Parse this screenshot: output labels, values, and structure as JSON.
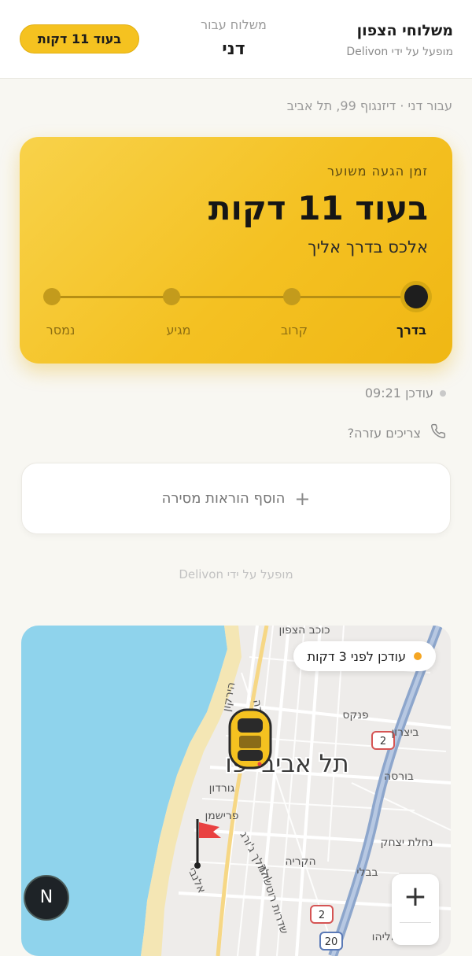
{
  "header": {
    "brand_title": "משלוחי הצפון",
    "brand_subtitle": "מופעל על ידי Delivon",
    "for_label": "משלוח עבור",
    "for_name": "דני",
    "eta_pill": "בעוד 11 דקות"
  },
  "address": "עבור דני · דיזנגוף 99, תל אביב",
  "status_card": {
    "label": "זמן הגעה משוער",
    "eta": "בעוד 11 דקות",
    "driver_line": "אלכס בדרך אליך",
    "steps": [
      {
        "label": "בדרך",
        "active": true
      },
      {
        "label": "קרוב",
        "active": false
      },
      {
        "label": "מגיע",
        "active": false
      },
      {
        "label": "נמסר",
        "active": false
      }
    ]
  },
  "updated_text": "עודכן 09:21",
  "help_text": "צריכים עזרה?",
  "add_instructions": {
    "plus": "+",
    "label": "הוסף הוראות מסירה"
  },
  "powered_by": "מופעל על ידי Delivon",
  "map": {
    "badge_text": "עודכן לפני 3 דקות",
    "city_label": "תל אביב-יפו",
    "labels": {
      "kochav": "כוכב הצפון",
      "hayarkon": "הירקון",
      "ben_yehuda": "בן יהודה",
      "pinkas": "פנקס",
      "bursa": "בורסה",
      "gordon": "גורדון",
      "frishman": "פרישמן",
      "king_george": "המלך ג'ורג'",
      "hakirya": "הקריה",
      "nahalat": "נחלת יצחק",
      "rothschild": "שדרות רוטשילד",
      "allenby": "אלנבי",
      "bitzaron": "ביצרון",
      "bavli": "בבלי",
      "yad_eliyahu": "יד אליהו"
    },
    "route_badges": [
      "2",
      "2",
      "20"
    ],
    "zoom_in": "+",
    "logo_letter": "N",
    "colors": {
      "sea": "#8fd3ec",
      "land": "#eeecea",
      "highway": "#8da6cc",
      "taxi": "#f5c220",
      "flag": "#e94141"
    }
  }
}
